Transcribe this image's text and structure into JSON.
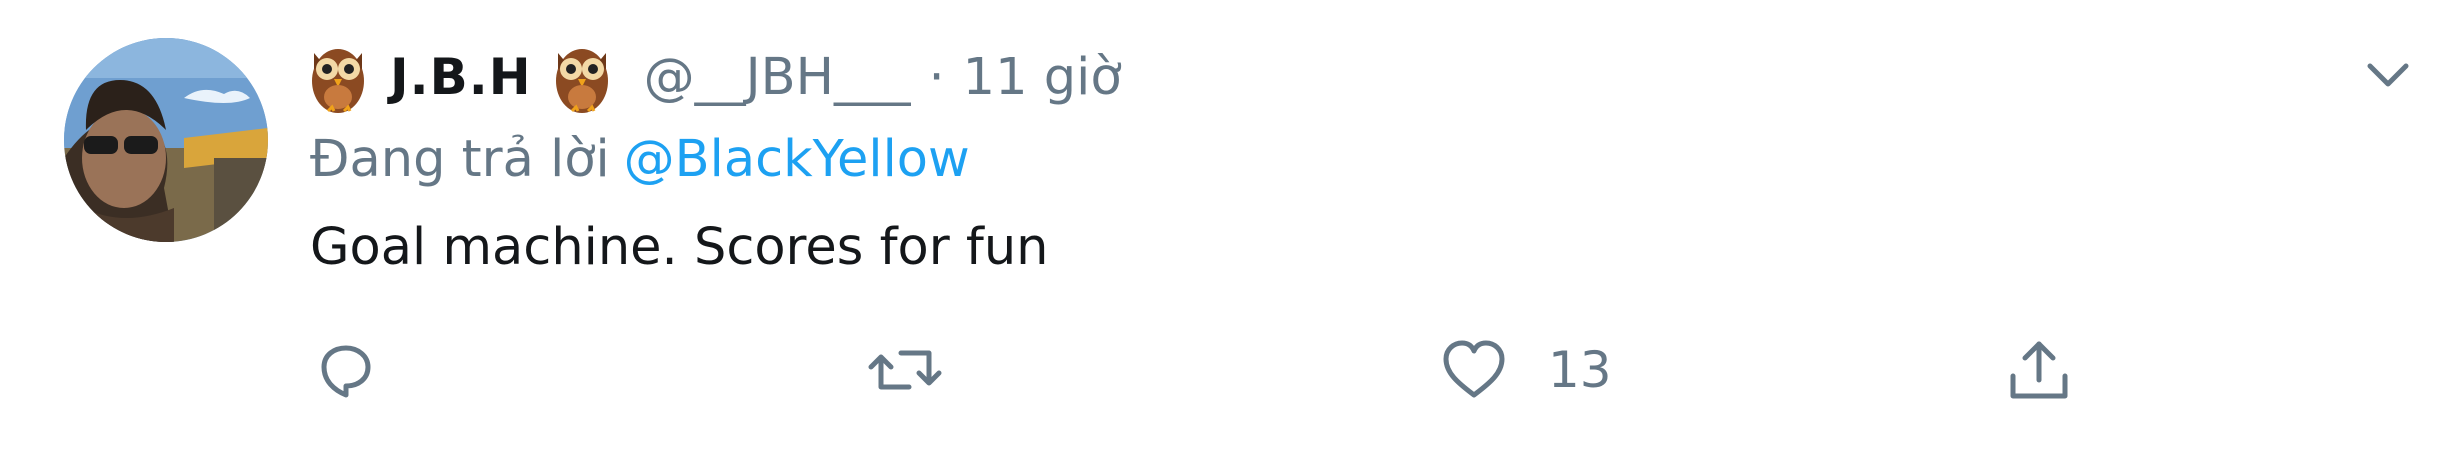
{
  "tweet": {
    "display_name": "J.B.H",
    "handle": "@__JBH___",
    "separator": "·",
    "time": "11 giờ",
    "reply_prefix": "Đang trả lời",
    "reply_to": "@BlackYellow",
    "text": "Goal machine. Scores for fun",
    "name_emoji": "owl-emoji"
  },
  "actions": {
    "reply": {
      "icon": "reply-icon",
      "count": ""
    },
    "retweet": {
      "icon": "retweet-icon",
      "count": ""
    },
    "like": {
      "icon": "heart-icon",
      "count": "13"
    },
    "share": {
      "icon": "share-icon",
      "count": ""
    }
  },
  "menu": {
    "icon": "chevron-down-icon"
  },
  "colors": {
    "text": "#14171a",
    "secondary": "#657786",
    "link": "#1da1f2",
    "background": "#ffffff"
  }
}
